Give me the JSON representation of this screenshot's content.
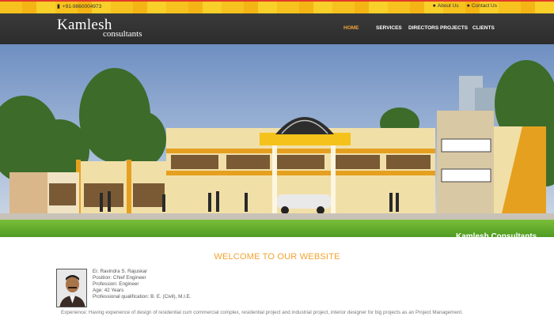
{
  "topbar": {
    "phone": "+91-9860004973",
    "links": [
      {
        "label": "About Us",
        "icon": "user-icon"
      },
      {
        "label": "Contact Us",
        "icon": "user-icon"
      }
    ]
  },
  "brand": {
    "name_line1": "Kamlesh",
    "name_line2": "consultants"
  },
  "nav": {
    "items": [
      {
        "label": "HOME",
        "active": true
      },
      {
        "label": "SERVICES",
        "active": false
      },
      {
        "label": "DIRECTORS",
        "active": false
      },
      {
        "label": "PROJECTS",
        "active": false
      },
      {
        "label": "CLIENTS",
        "active": false
      }
    ]
  },
  "slider": {
    "caption": "Kamlesh Consultants",
    "slide_count": 3,
    "active_slide": 1
  },
  "welcome": {
    "title": "WELCOME TO OUR WEBSITE"
  },
  "profile": {
    "lines": [
      "Er. Ravindra S. Rajuskar",
      "Position: Chief Engineer",
      "Profession: Engineer",
      "Age: 42 Years",
      "Professional qualification: B. E. (Civil), M.I.E."
    ],
    "experience": "Experience: Having experience of design of residential cum commercial complex, residential project and industrial project, interior designer for big projects as an Project Management."
  },
  "colors": {
    "accent": "#f3a32e",
    "topbar": "#f7c21d",
    "navbar": "#333333"
  }
}
